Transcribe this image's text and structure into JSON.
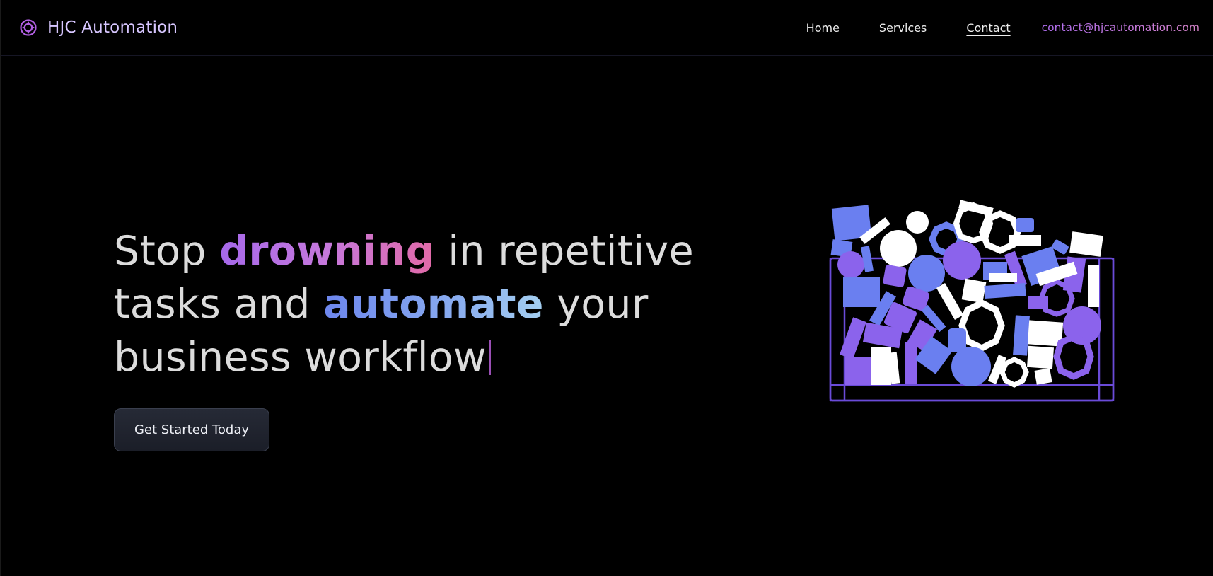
{
  "nav": {
    "brand_name": "HJC Automation",
    "brand_icon": "gear-icon",
    "links": [
      {
        "label": "Home",
        "active": false
      },
      {
        "label": "Services",
        "active": false
      },
      {
        "label": "Contact",
        "active": true
      }
    ],
    "email": "contact@hjcautomation.com"
  },
  "hero": {
    "line1": {
      "pre": "Stop ",
      "highlight": "drowning",
      "post": " in repetitive"
    },
    "line2": {
      "pre": "tasks and ",
      "highlight": "automate",
      "post": " your"
    },
    "line3": {
      "text": "business workflow"
    },
    "cta_label": "Get Started Today"
  },
  "colors": {
    "background": "#000000",
    "brand_purple": "#d7c6ff",
    "accent_pink": "#e16aa7",
    "accent_purple": "#a568ea",
    "accent_blue": "#6d86ee",
    "shape_blue": "#6a7ff0",
    "shape_violet": "#8b63ec",
    "shape_white": "#ffffff",
    "bin_outline": "#6a4bd8"
  },
  "illustration": {
    "icon": "shapes-bin-illustration"
  }
}
